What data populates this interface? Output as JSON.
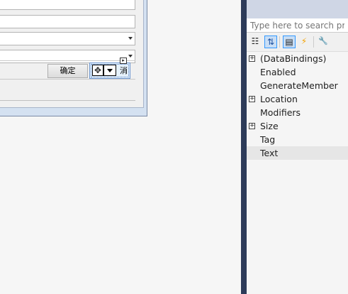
{
  "form": {
    "ok_label": "确定",
    "cancel_label_visible": "消",
    "move_glyph": "✥",
    "smart_tag_glyph": "▸"
  },
  "properties": {
    "search_placeholder": "Type here to search properties",
    "toolbar": [
      {
        "name": "categorized",
        "icon": "categorized-icon",
        "glyph": "☷"
      },
      {
        "name": "alphabetical",
        "icon": "sort-az-icon",
        "glyph": "⇅",
        "active": true
      },
      {
        "name": "properties",
        "icon": "properties-icon",
        "glyph": "▤",
        "active": true
      },
      {
        "name": "events",
        "icon": "lightning-icon",
        "glyph": "⚡"
      },
      {
        "name": "property-pages",
        "icon": "wrench-icon",
        "glyph": "🔧"
      }
    ],
    "items": [
      {
        "label": "(DataBindings)",
        "expandable": true
      },
      {
        "label": "Enabled",
        "expandable": false
      },
      {
        "label": "GenerateMember",
        "expandable": false
      },
      {
        "label": "Location",
        "expandable": true
      },
      {
        "label": "Modifiers",
        "expandable": false
      },
      {
        "label": "Size",
        "expandable": true
      },
      {
        "label": "Tag",
        "expandable": false
      },
      {
        "label": "Text",
        "expandable": false,
        "selected": true
      }
    ],
    "expander_glyph": "+"
  },
  "colors": {
    "pane_frame": "#2d3b59",
    "selection": "#3399ff",
    "events_icon": "#f5a300"
  }
}
